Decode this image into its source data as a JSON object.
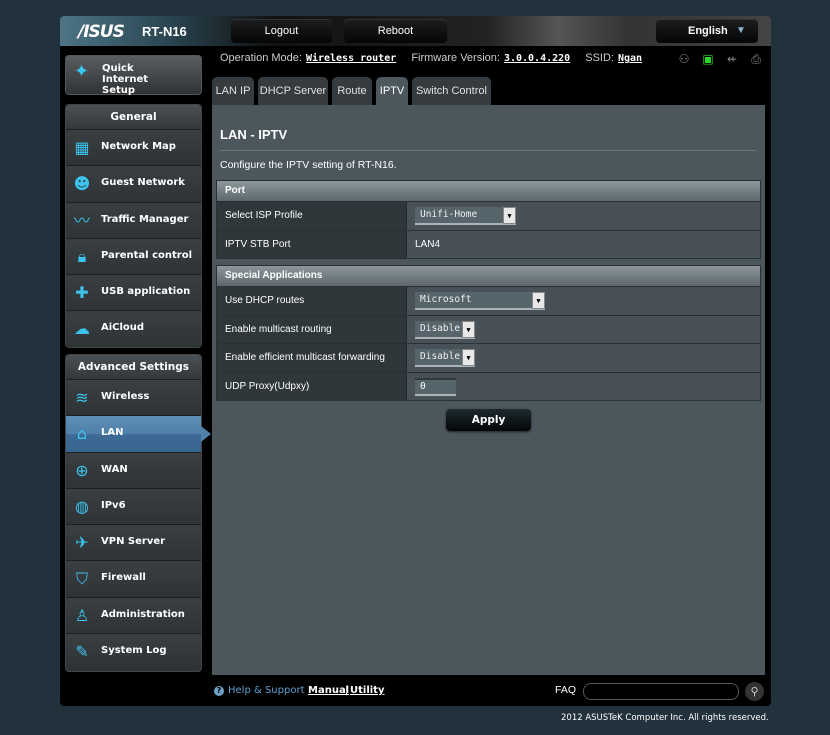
{
  "header": {
    "brand": "/ISUS",
    "model": "RT-N16",
    "logout_label": "Logout",
    "reboot_label": "Reboot",
    "language": "English"
  },
  "status_bar": {
    "operation_mode_label": "Operation Mode:",
    "operation_mode_value": "Wireless router",
    "firmware_label": "Firmware Version:",
    "firmware_value": "3.0.0.4.220",
    "ssid_label": "SSID:",
    "ssid_value": "Ngan",
    "icons": [
      "clients-icon",
      "network-status-icon",
      "usb-icon",
      "printer-icon"
    ]
  },
  "sidebar": {
    "quick_setup_label": "Quick Internet Setup",
    "general": {
      "title": "General",
      "items": [
        {
          "label": "Network Map",
          "icon": "network-map-icon"
        },
        {
          "label": "Guest Network",
          "icon": "guest-network-icon"
        },
        {
          "label": "Traffic Manager",
          "icon": "traffic-manager-icon"
        },
        {
          "label": "Parental control",
          "icon": "lock-icon"
        },
        {
          "label": "USB application",
          "icon": "puzzle-icon"
        },
        {
          "label": "AiCloud",
          "icon": "cloud-home-icon"
        }
      ]
    },
    "advanced": {
      "title": "Advanced Settings",
      "items": [
        {
          "label": "Wireless",
          "icon": "wifi-icon"
        },
        {
          "label": "LAN",
          "icon": "home-icon",
          "active": true
        },
        {
          "label": "WAN",
          "icon": "globe-icon"
        },
        {
          "label": "IPv6",
          "icon": "ipv6-icon"
        },
        {
          "label": "VPN Server",
          "icon": "vpn-icon"
        },
        {
          "label": "Firewall",
          "icon": "shield-icon"
        },
        {
          "label": "Administration",
          "icon": "admin-user-icon"
        },
        {
          "label": "System Log",
          "icon": "log-edit-icon"
        }
      ]
    }
  },
  "tabs": [
    {
      "label": "LAN IP"
    },
    {
      "label": "DHCP Server"
    },
    {
      "label": "Route"
    },
    {
      "label": "IPTV",
      "active": true
    },
    {
      "label": "Switch Control"
    }
  ],
  "main": {
    "title": "LAN - IPTV",
    "description": "Configure the IPTV setting of RT-N16.",
    "port_section": {
      "title": "Port",
      "isp_profile_label": "Select ISP Profile",
      "isp_profile_value": "Unifi-Home",
      "stb_port_label": "IPTV STB Port",
      "stb_port_value": "LAN4"
    },
    "special_section": {
      "title": "Special Applications",
      "dhcp_routes_label": "Use DHCP routes",
      "dhcp_routes_value": "Microsoft",
      "multicast_routing_label": "Enable multicast routing",
      "multicast_routing_value": "Disable",
      "efficient_multicast_label": "Enable efficient multicast forwarding",
      "efficient_multicast_value": "Disable",
      "udpxy_label": "UDP Proxy(Udpxy)",
      "udpxy_value": "0"
    },
    "apply_label": "Apply"
  },
  "footer": {
    "help_label": "Help & Support",
    "manual_label": "Manual",
    "separator": "|",
    "utility_label": "Utility",
    "faq_label": "FAQ",
    "faq_value": "",
    "copyright": "2012 ASUSTeK Computer Inc. All rights reserved."
  }
}
